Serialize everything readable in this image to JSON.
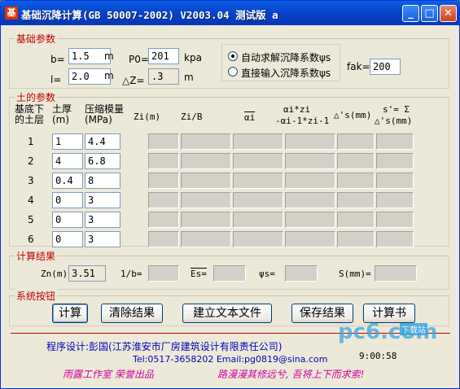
{
  "window": {
    "title": "基础沉降计算(GB 50007-2002) V2003.04 测试版 a",
    "buttons": {
      "minimize": "_",
      "maximize": "□",
      "close": "✕"
    }
  },
  "base_params": {
    "legend": "基础参数",
    "b_label": "b=",
    "b_value": "1.5",
    "b_unit": "m",
    "l_label": "l=",
    "l_value": "2.0",
    "l_unit": "m",
    "p0_label": "P0=",
    "p0_value": "201",
    "p0_unit": "kpa",
    "dz_label": "△Z=",
    "dz_value": ".3",
    "dz_unit": "m",
    "radio_auto": "自动求解沉降系数ψs",
    "radio_manual": "直接输入沉降系数ψs",
    "fak_label": "fak=",
    "fak_value": "200"
  },
  "soil": {
    "legend": "土的参数",
    "headers": {
      "layer": "基底下的土层",
      "thickness": "土厚(m)",
      "modulus": "压缩模量(MPa)",
      "zi": "Zi(m)",
      "zib": "Zi/B",
      "alpha": "αi",
      "alpha_diff_top": "αi*zi",
      "alpha_diff_bottom": "-αi-1*zi-1",
      "ds": "△'s(mm)",
      "sum_top": "s'= Σ",
      "sum_bottom": "△'s(mm)"
    },
    "rows": [
      {
        "no": "1",
        "thickness": "1",
        "modulus": "4.4"
      },
      {
        "no": "2",
        "thickness": "4",
        "modulus": "6.8"
      },
      {
        "no": "3",
        "thickness": "0.4",
        "modulus": "8"
      },
      {
        "no": "4",
        "thickness": "0",
        "modulus": "3"
      },
      {
        "no": "5",
        "thickness": "0",
        "modulus": "3"
      },
      {
        "no": "6",
        "thickness": "0",
        "modulus": "3"
      }
    ]
  },
  "results": {
    "legend": "计算结果",
    "zn_label": "Zn(m)",
    "zn_value": "3.51",
    "lb_label": "1/b=",
    "es_label": "Es=",
    "psi_label": "ψs=",
    "s_label": "S(mm)="
  },
  "buttons": {
    "legend": "系统按钮",
    "calc": "计算",
    "clear": "清除结果",
    "text_file": "建立文本文件",
    "save": "保存结果",
    "report": "计算书"
  },
  "footer": {
    "designer": "程序设计:彭国(江苏淮安市厂房建筑设计有限责任公司)",
    "contact": "Tel:0517-3658202    Email:pg0819@sina.com",
    "clock": "9:00:58",
    "left_motto": "雨露工作室 荣誉出品",
    "right_motto": "路漫漫其修远兮, 吾将上下而求索!",
    "watermark": "pc6.com",
    "watermark_sub": "下载站"
  },
  "colors": {
    "accent": "#c00000",
    "title_blue": "#0842c7",
    "link_blue": "#0000c0",
    "motto_pink": "#d000a0"
  }
}
